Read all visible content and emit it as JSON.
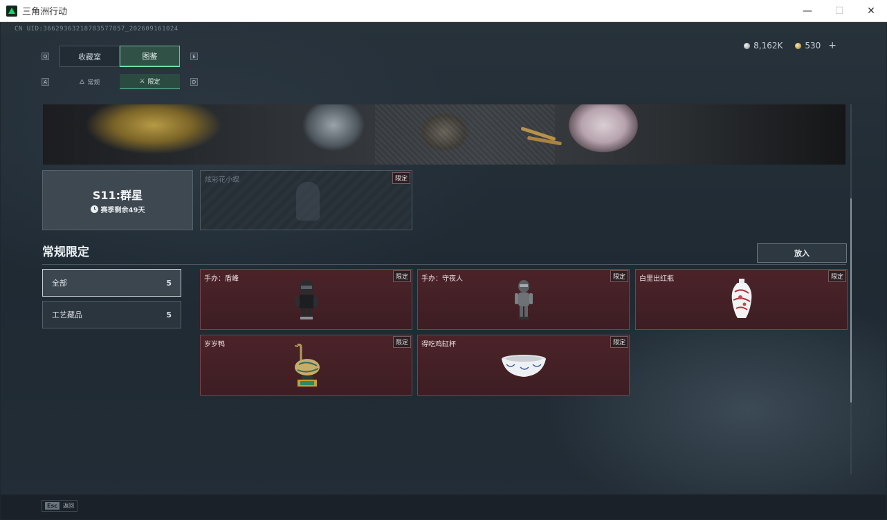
{
  "window": {
    "title": "三角洲行动",
    "controls": {
      "minimize": "—",
      "maximize": "☐",
      "close": "✕"
    }
  },
  "uid": "CN UID:36629363218783577057_202609161024",
  "currency": [
    {
      "icon": "silver-coin-icon",
      "value": "8,162K"
    },
    {
      "icon": "gold-coin-icon",
      "value": "530"
    }
  ],
  "currency_plus": "+",
  "keys": {
    "prev_main": "Q",
    "next_main": "E",
    "prev_sub": "A",
    "next_sub": "D"
  },
  "main_tabs": [
    {
      "label": "收藏室",
      "active": false
    },
    {
      "label": "图鉴",
      "active": true
    }
  ],
  "sub_tabs": [
    {
      "label": "常规",
      "icon": "flame-icon",
      "glyph": "🜂",
      "active": false
    },
    {
      "label": "限定",
      "icon": "crossed-swords-icon",
      "glyph": "⚔",
      "active": true
    }
  ],
  "season": {
    "title": "S11:群星",
    "remaining": "赛季剩余49天"
  },
  "season_items": [
    {
      "name": "炫彩花小蝶",
      "badge": "限定",
      "locked": true
    }
  ],
  "section": {
    "title": "常规限定",
    "place_button": "放入"
  },
  "filters": [
    {
      "label": "全部",
      "count": "5",
      "active": true
    },
    {
      "label": "工艺藏品",
      "count": "5",
      "active": false
    }
  ],
  "items": [
    {
      "name": "手办：盾峰",
      "badge": "限定",
      "art": "figure-dark"
    },
    {
      "name": "手办：守夜人",
      "badge": "限定",
      "art": "figure-silver"
    },
    {
      "name": "白里出红瓶",
      "badge": "限定",
      "art": "vase"
    },
    {
      "name": "岁岁鸭",
      "badge": "限定",
      "art": "duck"
    },
    {
      "name": "得吃鸡缸杯",
      "badge": "限定",
      "art": "bowl"
    }
  ],
  "footer": {
    "esc_key": "Esc",
    "esc_label": "返回"
  },
  "colors": {
    "accent_green": "#6fe0ad",
    "item_bg": "#4b2329",
    "app_bg": "#1f2a33"
  }
}
